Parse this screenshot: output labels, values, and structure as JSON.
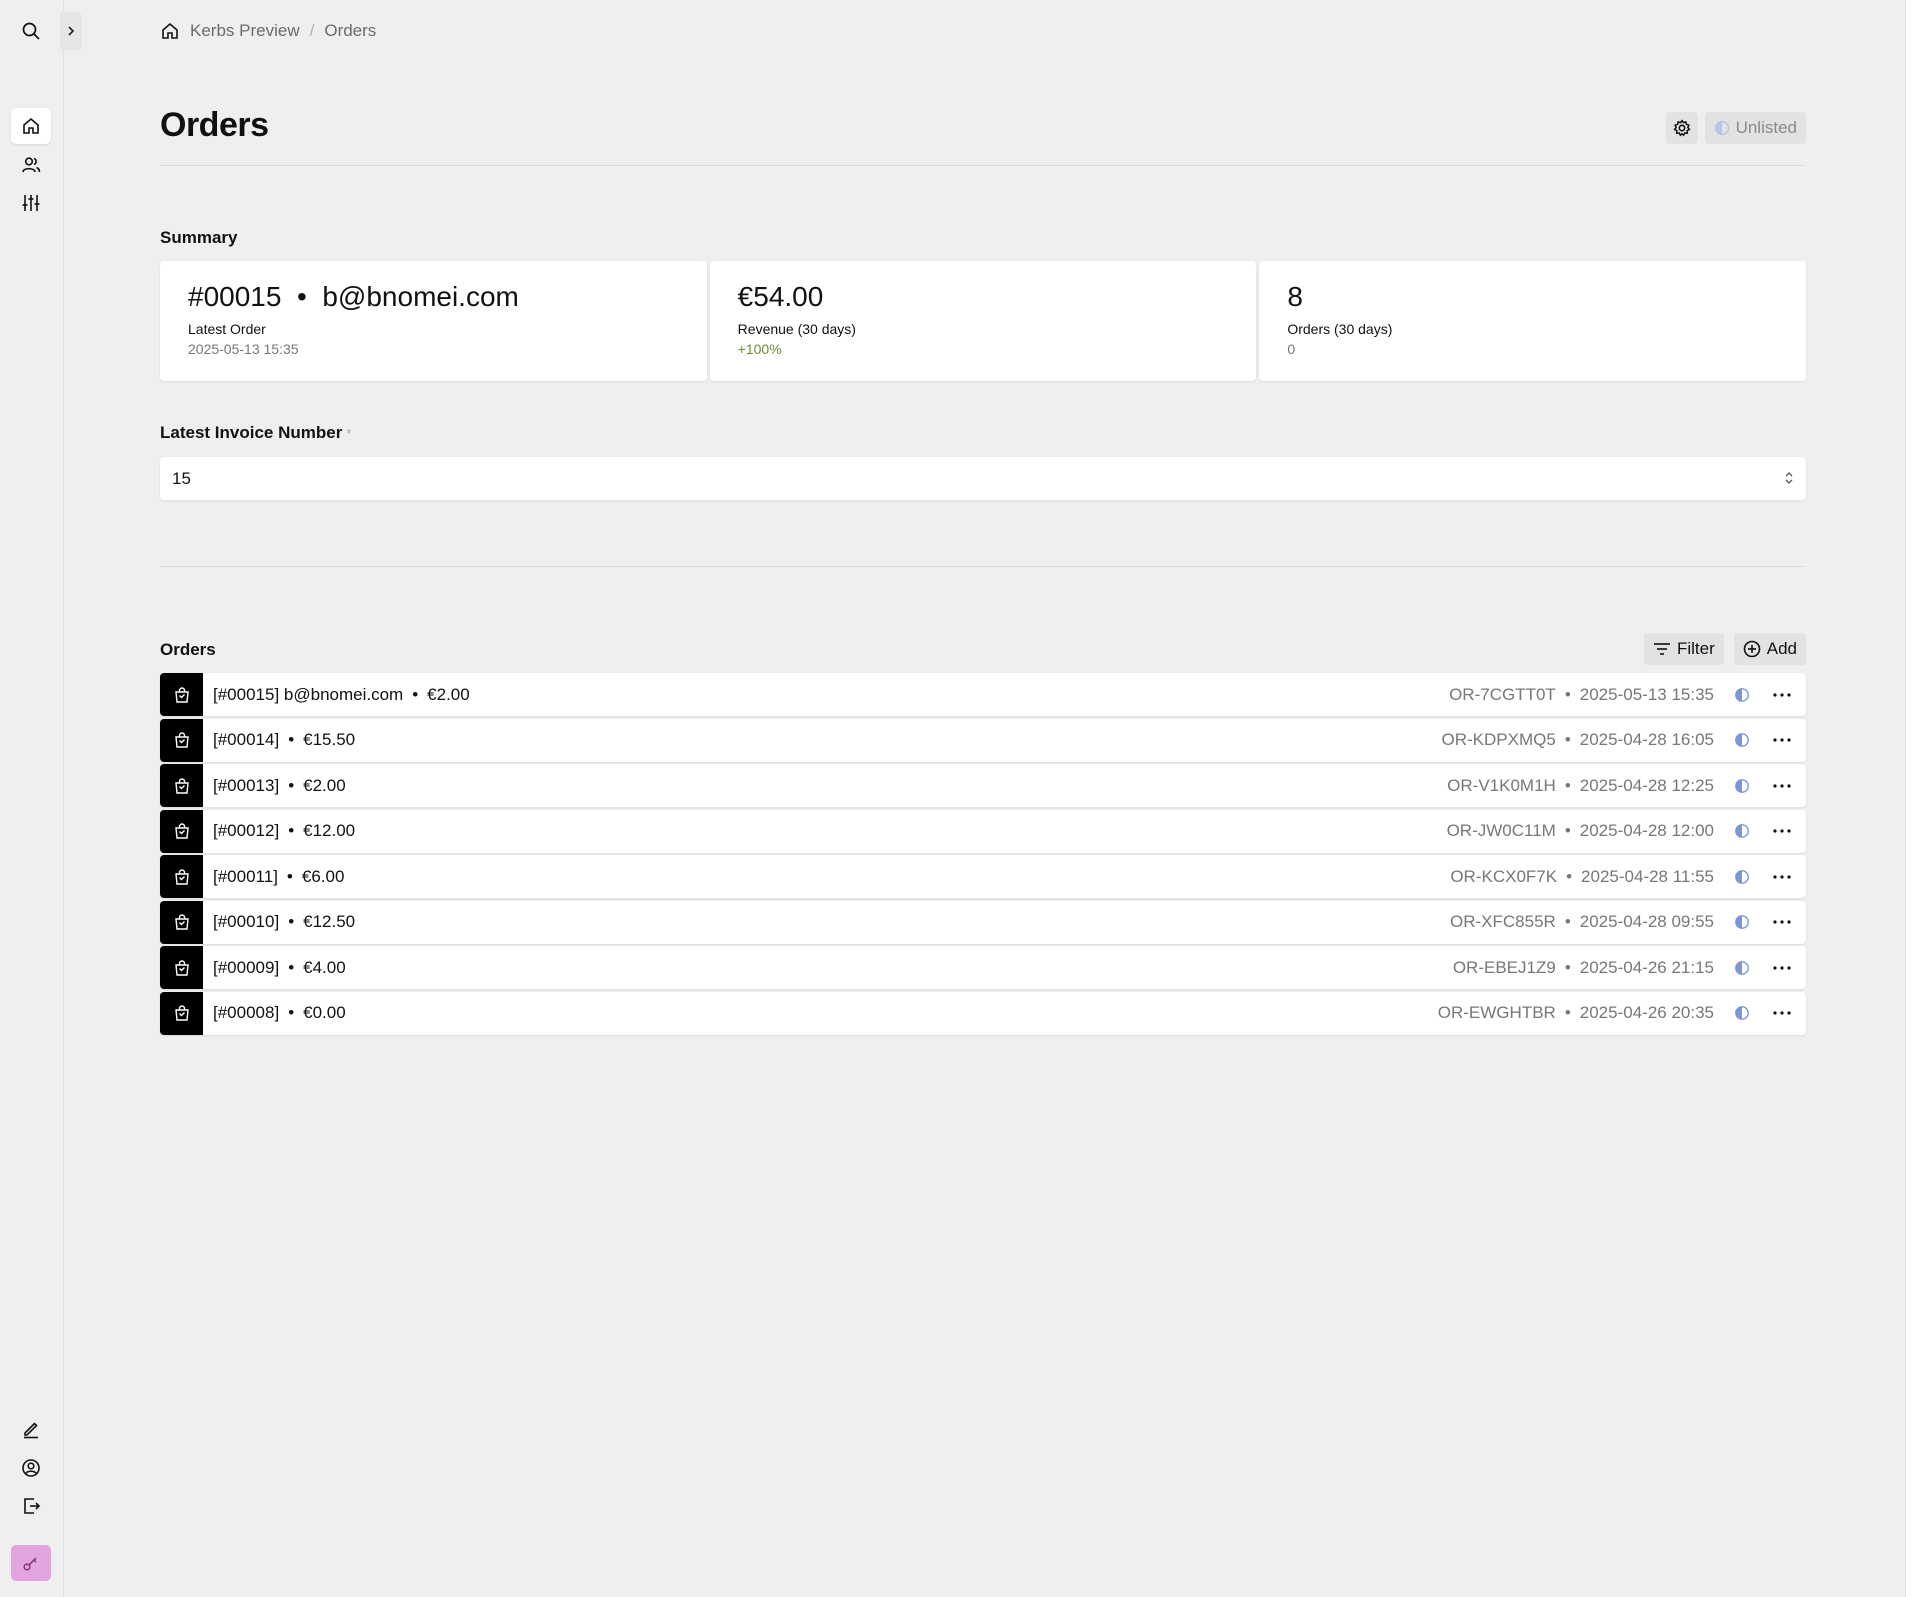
{
  "breadcrumb": {
    "site": "Kerbs Preview",
    "separator": "/",
    "page": "Orders"
  },
  "header": {
    "title": "Orders",
    "status_label": "Unlisted"
  },
  "summary": {
    "label": "Summary",
    "stats": [
      {
        "value": "#00015  •  b@bnomei.com",
        "label": "Latest Order",
        "info": "2025-05-13 15:35"
      },
      {
        "value": "€54.00",
        "label": "Revenue (30 days)",
        "info": "+100%"
      },
      {
        "value": "8",
        "label": "Orders (30 days)",
        "info": "0"
      }
    ]
  },
  "invoice": {
    "label": "Latest Invoice Number",
    "required_mark": "*",
    "value": "15"
  },
  "orders": {
    "title": "Orders",
    "filter_label": "Filter",
    "add_label": "Add",
    "items": [
      {
        "text": "[#00015] b@bnomei.com",
        "amount": "€2.00",
        "id": "OR-7CGTT0T",
        "date": "2025-05-13 15:35"
      },
      {
        "text": "[#00014]",
        "amount": "€15.50",
        "id": "OR-KDPXMQ5",
        "date": "2025-04-28 16:05"
      },
      {
        "text": "[#00013]",
        "amount": "€2.00",
        "id": "OR-V1K0M1H",
        "date": "2025-04-28 12:25"
      },
      {
        "text": "[#00012]",
        "amount": "€12.00",
        "id": "OR-JW0C11M",
        "date": "2025-04-28 12:00"
      },
      {
        "text": "[#00011]",
        "amount": "€6.00",
        "id": "OR-KCX0F7K",
        "date": "2025-04-28 11:55"
      },
      {
        "text": "[#00010]",
        "amount": "€12.50",
        "id": "OR-XFC855R",
        "date": "2025-04-28 09:55"
      },
      {
        "text": "[#00009]",
        "amount": "€4.00",
        "id": "OR-EBEJ1Z9",
        "date": "2025-04-26 21:15"
      },
      {
        "text": "[#00008]",
        "amount": "€0.00",
        "id": "OR-EWGHTBR",
        "date": "2025-04-26 20:35"
      }
    ]
  },
  "colors": {
    "accent": "#7f95d6",
    "positive": "#6f8a3a",
    "license": "#e3a5e0"
  },
  "icons": {
    "sidebar_top": [
      "search-icon",
      "home-icon",
      "users-icon",
      "sliders-icon"
    ],
    "sidebar_bottom": [
      "pencil-icon",
      "account-icon",
      "logout-icon",
      "key-icon"
    ]
  }
}
